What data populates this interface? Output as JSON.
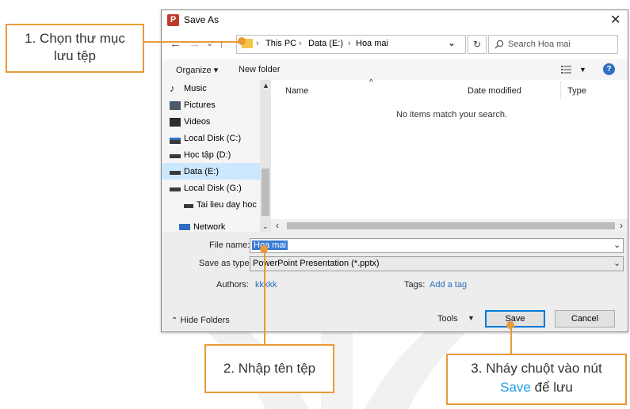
{
  "dialog": {
    "title": "Save As",
    "close_glyph": "✕",
    "app_icon_letter": "P",
    "nav": {
      "back": "←",
      "forward": "→",
      "up": "↑",
      "recent": "⌄"
    },
    "breadcrumb": [
      "This PC",
      "Data (E:)",
      "Hoa mai"
    ],
    "search_placeholder": "Search Hoa mai",
    "toolbar": {
      "organize": "Organize ▾",
      "new_folder": "New folder",
      "help": "?"
    },
    "nav_pane": [
      "Music",
      "Pictures",
      "Videos",
      "Local Disk (C:)",
      "Học tập (D:)",
      "Data (E:)",
      "Local Disk (G:)",
      "Tai lieu day hoc",
      "Network"
    ],
    "columns": {
      "name": "Name",
      "date_modified": "Date modified",
      "type": "Type"
    },
    "empty_message": "No items match your search.",
    "file_name_label": "File name:",
    "file_name_value": "Hoa mai",
    "save_as_type_label": "Save as type:",
    "save_as_type_value": "PowerPoint Presentation (*.pptx)",
    "authors_label": "Authors:",
    "authors_value": "kkkkk",
    "tags_label": "Tags:",
    "tags_value": "Add a tag",
    "hide_folders": "Hide Folders",
    "tools": "Tools",
    "save": "Save",
    "cancel": "Cancel"
  },
  "callouts": {
    "c1_line1": "1. Chọn thư mục",
    "c1_line2": "lưu tệp",
    "c2": "2. Nhập tên tệp",
    "c3_line1": "3. Nháy chuột vào nút",
    "c3_save": "Save",
    "c3_tail": " để lưu"
  },
  "colors": {
    "callout_border": "#e89a36",
    "selection": "#3a7bd5",
    "accent": "#0078d7",
    "link": "#1f9ce6"
  }
}
